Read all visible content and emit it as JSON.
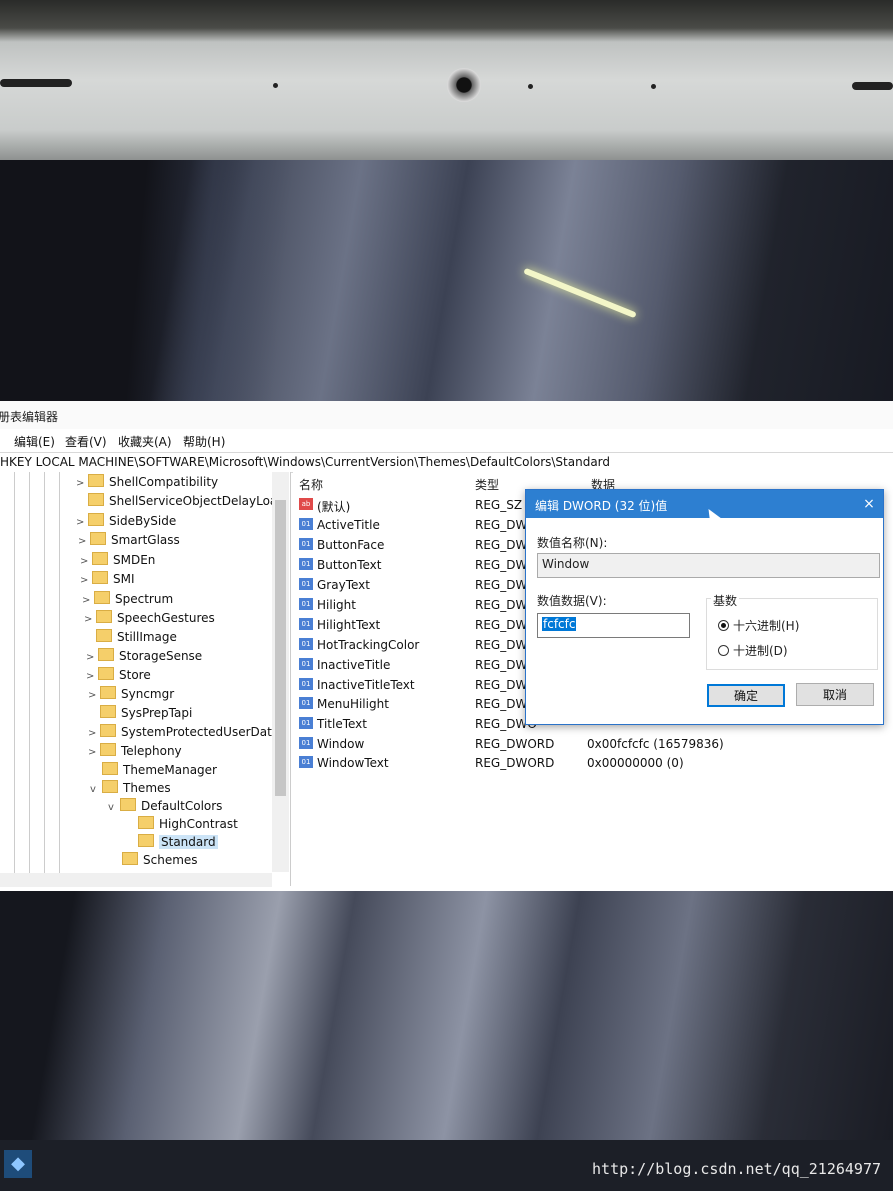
{
  "window": {
    "title": "册表编辑器",
    "menu": [
      "编辑(E)",
      "查看(V)",
      "收藏夹(A)",
      "帮助(H)"
    ],
    "address": "HKEY LOCAL MACHINE\\SOFTWARE\\Microsoft\\Windows\\CurrentVersion\\Themes\\DefaultColors\\Standard"
  },
  "tree": {
    "items": [
      {
        "label": "ShellCompatibility",
        "arrow": ">"
      },
      {
        "label": "ShellServiceObjectDelayLoa",
        "arrow": ""
      },
      {
        "label": "SideBySide",
        "arrow": ">"
      },
      {
        "label": "SmartGlass",
        "arrow": ">"
      },
      {
        "label": "SMDEn",
        "arrow": ">"
      },
      {
        "label": "SMI",
        "arrow": ">"
      },
      {
        "label": "Spectrum",
        "arrow": ">"
      },
      {
        "label": "SpeechGestures",
        "arrow": ">"
      },
      {
        "label": "StillImage",
        "arrow": ""
      },
      {
        "label": "StorageSense",
        "arrow": ">"
      },
      {
        "label": "Store",
        "arrow": ">"
      },
      {
        "label": "Syncmgr",
        "arrow": ">"
      },
      {
        "label": "SysPrepTapi",
        "arrow": ""
      },
      {
        "label": "SystemProtectedUserData",
        "arrow": ">"
      },
      {
        "label": "Telephony",
        "arrow": ">"
      },
      {
        "label": "ThemeManager",
        "arrow": ""
      },
      {
        "label": "Themes",
        "arrow": "v"
      },
      {
        "label": "DefaultColors",
        "arrow": "v"
      },
      {
        "label": "HighContrast",
        "arrow": ""
      },
      {
        "label": "Standard",
        "arrow": ""
      },
      {
        "label": "Schemes",
        "arrow": ""
      }
    ]
  },
  "values": {
    "headers": {
      "name": "名称",
      "type": "类型",
      "data": "数据"
    },
    "rows": [
      {
        "name": "(默认)",
        "type": "REG_SZ",
        "data": ""
      },
      {
        "name": "ActiveTitle",
        "type": "REG_DWO",
        "data": ""
      },
      {
        "name": "ButtonFace",
        "type": "REG_DWO",
        "data": ""
      },
      {
        "name": "ButtonText",
        "type": "REG_DWO",
        "data": ""
      },
      {
        "name": "GrayText",
        "type": "REG_DWO",
        "data": ""
      },
      {
        "name": "Hilight",
        "type": "REG_DWO",
        "data": ""
      },
      {
        "name": "HilightText",
        "type": "REG_DWO",
        "data": ""
      },
      {
        "name": "HotTrackingColor",
        "type": "REG_DWO",
        "data": ""
      },
      {
        "name": "InactiveTitle",
        "type": "REG_DWO",
        "data": ""
      },
      {
        "name": "InactiveTitleText",
        "type": "REG_DWO",
        "data": ""
      },
      {
        "name": "MenuHilight",
        "type": "REG_DWO",
        "data": ""
      },
      {
        "name": "TitleText",
        "type": "REG_DWO",
        "data": ""
      },
      {
        "name": "Window",
        "type": "REG_DWORD",
        "data": "0x00fcfcfc (16579836)"
      },
      {
        "name": "WindowText",
        "type": "REG_DWORD",
        "data": "0x00000000 (0)"
      }
    ]
  },
  "dialog": {
    "title": "编辑 DWORD (32 位)值",
    "close": "×",
    "name_label": "数值名称(N):",
    "name_value": "Window",
    "data_label": "数值数据(V):",
    "data_value": "fcfcfc",
    "base_label": "基数",
    "radio_hex": "十六进制(H)",
    "radio_dec": "十进制(D)",
    "ok": "确定",
    "cancel": "取消"
  },
  "watermark": "http://blog.csdn.net/qq_21264977"
}
